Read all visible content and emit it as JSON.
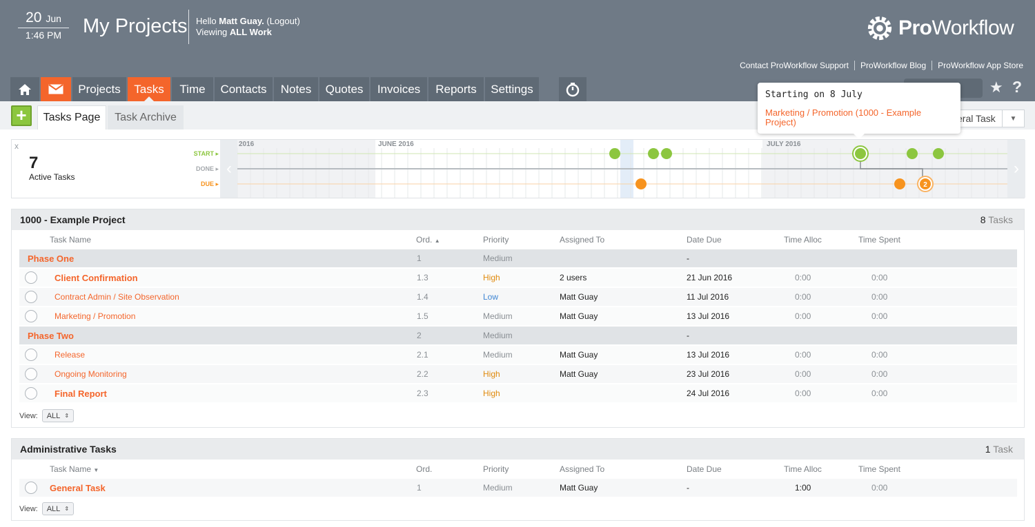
{
  "header": {
    "date_day": "20",
    "date_month": "Jun",
    "time": "1:46 PM",
    "title": "My Projects",
    "hello_prefix": "Hello",
    "user_name": "Matt Guay.",
    "logout": "(Logout)",
    "viewing_prefix": "Viewing",
    "viewing_value": "ALL Work",
    "logo_bold": "Pro",
    "logo_rest": "Workflow",
    "links": [
      "Contact ProWorkflow Support",
      "ProWorkflow Blog",
      "ProWorkflow App Store"
    ]
  },
  "nav": {
    "items": [
      {
        "label": "",
        "icon": "home-icon"
      },
      {
        "label": "",
        "icon": "mail-icon"
      },
      {
        "label": "Projects"
      },
      {
        "label": "Tasks",
        "active": true
      },
      {
        "label": "Time"
      },
      {
        "label": "Contacts"
      },
      {
        "label": "Notes"
      },
      {
        "label": "Quotes"
      },
      {
        "label": "Invoices"
      },
      {
        "label": "Reports"
      },
      {
        "label": "Settings"
      }
    ]
  },
  "subbar": {
    "add_label": "+",
    "tab_active": "Tasks Page",
    "tab_archive": "Task Archive",
    "select_value": "eral Task"
  },
  "tooltip": {
    "title": "Starting on 8 July",
    "link": "Marketing / Promotion (1000 - Example Project)"
  },
  "timeline": {
    "count": "7",
    "label": "Active Tasks",
    "start": "START",
    "done": "DONE",
    "due": "DUE",
    "months": [
      "2016",
      "JUNE 2016",
      "JULY 2016"
    ],
    "due_badge": "2",
    "colors": {
      "start": "#8cc63f",
      "due": "#f7931e"
    }
  },
  "columns": [
    "Task Name",
    "Ord.",
    "Priority",
    "Assigned To",
    "Date Due",
    "Time Alloc",
    "Time Spent"
  ],
  "project1": {
    "title": "1000 - Example Project",
    "count": "8",
    "count_label": "Tasks",
    "rows": [
      {
        "kind": "phase",
        "name": "Phase One",
        "ord": "1",
        "priority": "Medium",
        "assigned": "",
        "due": "-",
        "alloc": "",
        "spent": ""
      },
      {
        "kind": "task",
        "name": "Client Confirmation",
        "bold": true,
        "ord": "1.3",
        "priority": "High",
        "assigned": "2 users",
        "due": "21 Jun 2016",
        "alloc": "0:00",
        "spent": "0:00"
      },
      {
        "kind": "task",
        "name": "Contract Admin / Site Observation",
        "ord": "1.4",
        "priority": "Low",
        "assigned": "Matt Guay",
        "due": "11 Jul 2016",
        "alloc": "0:00",
        "spent": "0:00"
      },
      {
        "kind": "task",
        "name": "Marketing / Promotion",
        "ord": "1.5",
        "priority": "Medium",
        "assigned": "Matt Guay",
        "due": "13 Jul 2016",
        "alloc": "0:00",
        "spent": "0:00"
      },
      {
        "kind": "phase",
        "name": "Phase Two",
        "ord": "2",
        "priority": "Medium",
        "assigned": "",
        "due": "-",
        "alloc": "",
        "spent": ""
      },
      {
        "kind": "task",
        "name": "Release",
        "ord": "2.1",
        "priority": "Medium",
        "assigned": "Matt Guay",
        "due": "13 Jul 2016",
        "alloc": "0:00",
        "spent": "0:00"
      },
      {
        "kind": "task",
        "name": "Ongoing Monitoring",
        "ord": "2.2",
        "priority": "High",
        "assigned": "Matt Guay",
        "due": "23 Jul 2016",
        "alloc": "0:00",
        "spent": "0:00"
      },
      {
        "kind": "task",
        "name": "Final Report",
        "bold": true,
        "ord": "2.3",
        "priority": "High",
        "assigned": "",
        "due": "24 Jul 2016",
        "alloc": "0:00",
        "spent": "0:00"
      }
    ],
    "view_label": "View:",
    "view_value": "ALL"
  },
  "project2": {
    "title": "Administrative Tasks",
    "count": "1",
    "count_label": "Task",
    "rows": [
      {
        "kind": "task",
        "name": "General Task",
        "bold": true,
        "ord": "1",
        "priority": "Medium",
        "assigned": "Matt Guay",
        "due": "-",
        "alloc": "1:00",
        "spent": "0:00"
      }
    ],
    "view_label": "View:",
    "view_value": "ALL"
  }
}
